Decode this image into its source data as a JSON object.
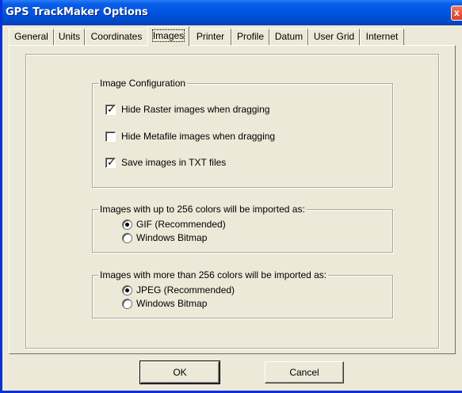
{
  "window": {
    "title": "GPS TrackMaker Options",
    "close_label": "x"
  },
  "tabs": [
    {
      "label": "General"
    },
    {
      "label": "Units"
    },
    {
      "label": "Coordinates"
    },
    {
      "label": "Images",
      "active": true
    },
    {
      "label": "Printer"
    },
    {
      "label": "Profile"
    },
    {
      "label": "Datum"
    },
    {
      "label": "User Grid"
    },
    {
      "label": "Internet"
    }
  ],
  "image_config": {
    "title": "Image Configuration",
    "options": [
      {
        "label": "Hide Raster images when dragging",
        "checked": true
      },
      {
        "label": "Hide Metafile images when dragging",
        "checked": false
      },
      {
        "label": "Save images in TXT files",
        "checked": true
      }
    ]
  },
  "low_color": {
    "title": "Images with up to 256 colors will be imported as:",
    "options": [
      {
        "label": "GIF (Recommended)",
        "selected": true
      },
      {
        "label": "Windows Bitmap",
        "selected": false
      }
    ]
  },
  "high_color": {
    "title": "Images with more than 256 colors will be imported as:",
    "options": [
      {
        "label": "JPEG (Recommended)",
        "selected": true
      },
      {
        "label": "Windows Bitmap",
        "selected": false
      }
    ]
  },
  "buttons": {
    "ok": "OK",
    "cancel": "Cancel"
  },
  "colors": {
    "title_bar": "#0054e3",
    "face": "#ece9d8",
    "window_border": "#0831d9"
  }
}
